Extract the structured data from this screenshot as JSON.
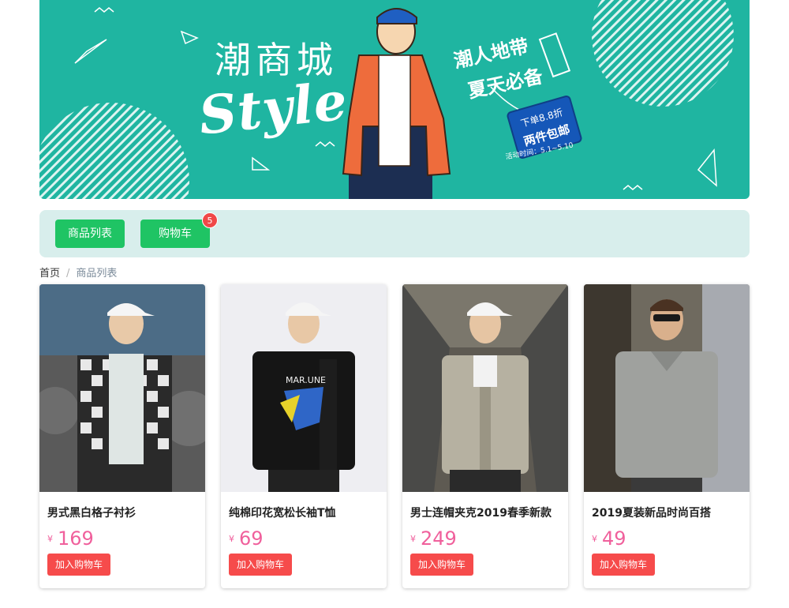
{
  "banner": {
    "title": "潮商城",
    "style_word": "Style",
    "tag_line1": "潮人地带",
    "tag_line2": "夏天必备",
    "price_tag_line1": "下单8.8折",
    "price_tag_line2": "两件包邮",
    "promo_date": "活动时间：5.1~5.10",
    "bg_color": "#1fb5a1"
  },
  "nav": {
    "product_list_label": "商品列表",
    "cart_label": "购物车",
    "cart_count": "5"
  },
  "breadcrumb": {
    "home": "首页",
    "separator": "/",
    "current": "商品列表"
  },
  "products": [
    {
      "name": "男式黑白格子衬衫",
      "currency": "¥",
      "price": "169",
      "button": "加入购物车",
      "image": "plaid-shirt-photo"
    },
    {
      "name": "纯棉印花宽松长袖T恤",
      "currency": "¥",
      "price": "69",
      "button": "加入购物车",
      "image": "black-print-tee-photo"
    },
    {
      "name": "男士连帽夹克2019春季新款",
      "currency": "¥",
      "price": "249",
      "button": "加入购物车",
      "image": "hooded-jacket-photo"
    },
    {
      "name": "2019夏装新品时尚百搭",
      "currency": "¥",
      "price": "49",
      "button": "加入购物车",
      "image": "grey-polo-photo"
    }
  ],
  "colors": {
    "nav_button": "#1fc464",
    "add_button": "#f64b4b",
    "price": "#f0609c",
    "badge": "#f04848"
  }
}
